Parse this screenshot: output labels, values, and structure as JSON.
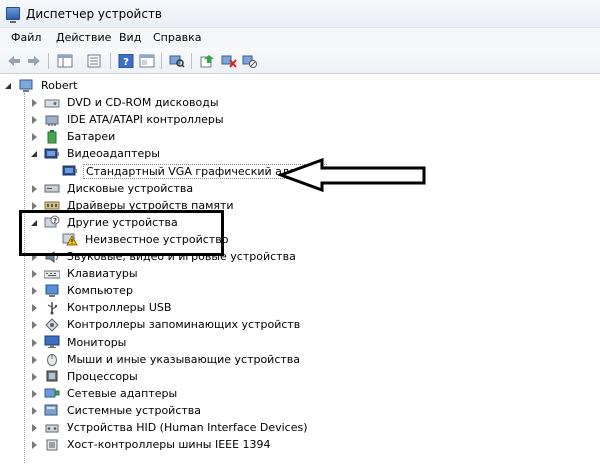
{
  "window": {
    "title": "Диспетчер устройств"
  },
  "menu": [
    "Файл",
    "Действие",
    "Вид",
    "Справка"
  ],
  "toolbar": [
    "back-icon",
    "forward-icon",
    "properties-icon",
    "console-tree-icon",
    "help-icon",
    "show-hide-icon",
    "scan-hardware-icon",
    "update-driver-icon",
    "uninstall-icon",
    "disable-icon"
  ],
  "tree": {
    "root": "Robert",
    "items": [
      {
        "label": "DVD и CD-ROM дисководы",
        "icon": "dvd-drive-icon"
      },
      {
        "label": "IDE ATA/ATAPI контроллеры",
        "icon": "ide-controller-icon"
      },
      {
        "label": "Батареи",
        "icon": "battery-icon"
      },
      {
        "label": "Видеоадаптеры",
        "icon": "display-adapter-icon",
        "expanded": true,
        "children": [
          {
            "label": "Стандартный VGA графический адаптер",
            "icon": "display-adapter-icon"
          }
        ]
      },
      {
        "label": "Дисковые устройства",
        "icon": "disk-drive-icon"
      },
      {
        "label": "Драйверы устройств памяти",
        "icon": "memory-driver-icon"
      },
      {
        "label": "Другие устройства",
        "icon": "other-devices-icon",
        "expanded": true,
        "children": [
          {
            "label": "Неизвестное устройство",
            "icon": "warning-device-icon"
          }
        ]
      },
      {
        "label": "Звуковые, видео и игровые устройства",
        "icon": "sound-icon"
      },
      {
        "label": "Клавиатуры",
        "icon": "keyboard-icon"
      },
      {
        "label": "Компьютер",
        "icon": "computer-icon"
      },
      {
        "label": "Контроллеры USB",
        "icon": "usb-icon"
      },
      {
        "label": "Контроллеры запоминающих устройств",
        "icon": "storage-controller-icon"
      },
      {
        "label": "Мониторы",
        "icon": "monitor-icon"
      },
      {
        "label": "Мыши и иные указывающие устройства",
        "icon": "mouse-icon"
      },
      {
        "label": "Процессоры",
        "icon": "processor-icon"
      },
      {
        "label": "Сетевые адаптеры",
        "icon": "network-adapter-icon"
      },
      {
        "label": "Системные устройства",
        "icon": "system-device-icon"
      },
      {
        "label": "Устройства HID (Human Interface Devices)",
        "icon": "hid-icon"
      },
      {
        "label": "Хост-контроллеры шины IEEE 1394",
        "icon": "ieee1394-icon"
      }
    ]
  },
  "colors": {
    "accent": "#2d5fa8",
    "warning": "#f0c020",
    "annotation": "#000000"
  }
}
